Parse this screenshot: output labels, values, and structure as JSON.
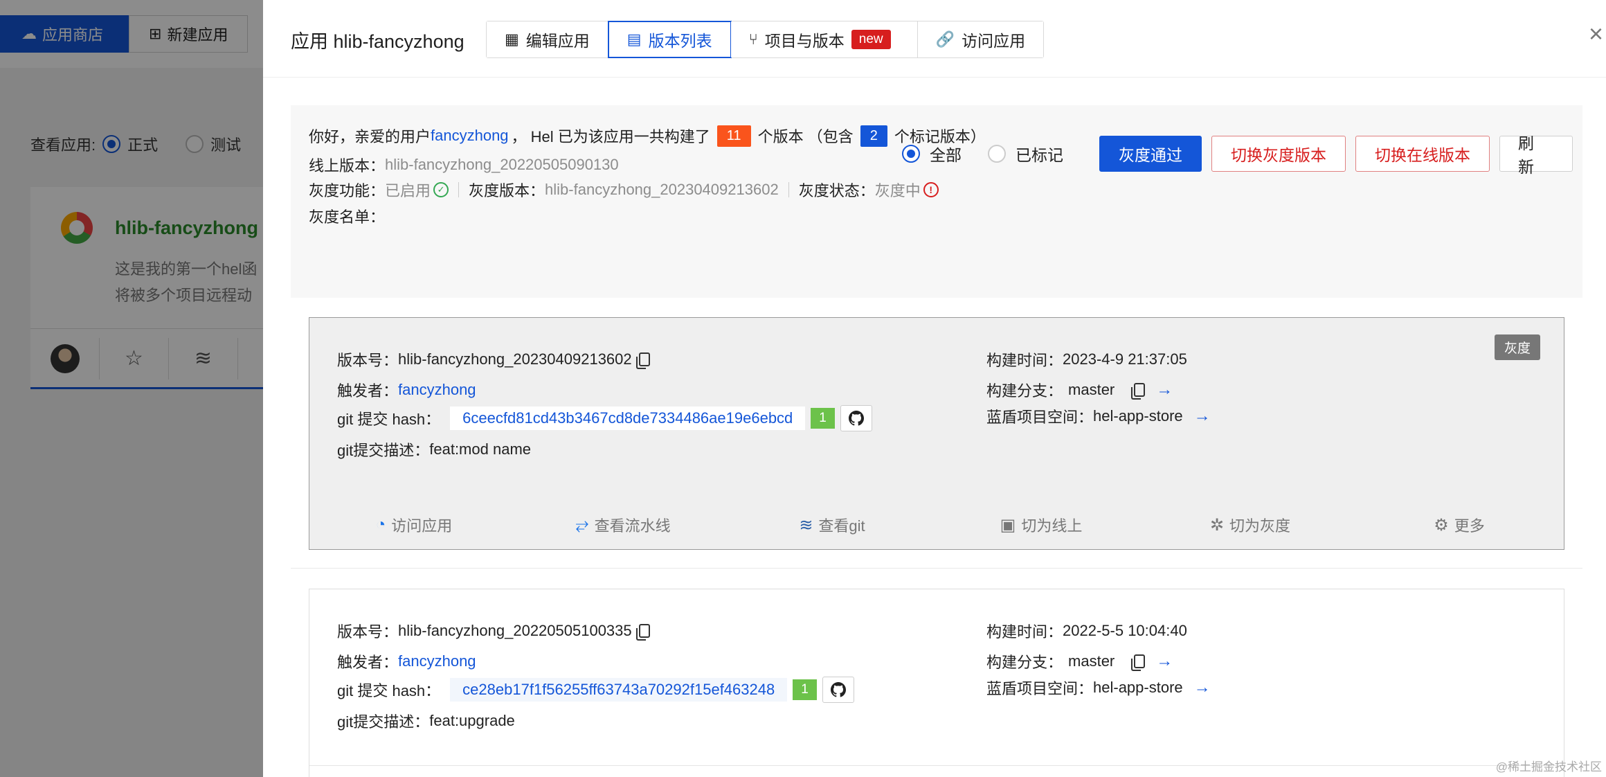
{
  "background": {
    "nav": [
      {
        "icon": "cloud-icon",
        "label": "应用商店"
      },
      {
        "icon": "plus-square-icon",
        "label": "新建应用"
      }
    ],
    "filter": {
      "label": "查看应用:",
      "options": [
        "正式",
        "测试"
      ]
    },
    "card": {
      "name": "hlib-fancyzhong",
      "desc_line1": "这是我的第一个hel函",
      "desc_line2": "将被多个项目远程动"
    }
  },
  "drawer": {
    "title": "应用 hlib-fancyzhong",
    "tabs": [
      {
        "label": "编辑应用",
        "icon": "grid-icon"
      },
      {
        "label": "版本列表",
        "icon": "list-icon"
      },
      {
        "label": "项目与版本",
        "icon": "branch-icon",
        "badge": "new"
      },
      {
        "label": "访问应用",
        "icon": "link-icon"
      }
    ],
    "close": "×"
  },
  "summary": {
    "greeting_prefix": "你好，亲爱的用户",
    "user": "fancyzhong",
    "greeting_mid": "，  Hel 已为该应用一共构建了",
    "total_versions": "11",
    "greeting_mid2": "个版本 （包含",
    "marked_versions": "2",
    "greeting_suffix": "个标记版本）",
    "online_label": "线上版本：",
    "online_value": "hlib-fancyzhong_20220505090130",
    "gray_feature_label": "灰度功能：",
    "gray_feature_value": "已启用",
    "gray_version_label": "灰度版本：",
    "gray_version_value": "hlib-fancyzhong_20230409213602",
    "gray_status_label": "灰度状态：",
    "gray_status_value": "灰度中",
    "gray_list_label": "灰度名单：",
    "colors": {
      "total_badge": "#fa541c",
      "marked_badge": "#1456d8"
    }
  },
  "controls": {
    "radio_all": "全部",
    "radio_marked": "已标记",
    "btn_pass": "灰度通过",
    "btn_switch_gray": "切换灰度版本",
    "btn_switch_online": "切换在线版本",
    "btn_refresh": "刷 新"
  },
  "versions": [
    {
      "tag": "灰度",
      "version_label": "版本号：",
      "version": "hlib-fancyzhong_20230409213602",
      "trigger_label": "触发者：",
      "trigger": "fancyzhong",
      "hash_label": "git 提交 hash：",
      "hash": "6ceecfd81cd43b3467cd8de7334486ae19e6ebcd",
      "hash_count": "1",
      "desc_label": "git提交描述：",
      "desc": "feat:mod name",
      "build_time_label": "构建时间：",
      "build_time": "2023-4-9 21:37:05",
      "branch_label": "构建分支：",
      "branch": "master",
      "space_label": "蓝盾项目空间：",
      "space": "hel-app-store",
      "actions": [
        {
          "icon": "visit-icon",
          "label": "访问应用"
        },
        {
          "icon": "pipeline-icon",
          "label": "查看流水线"
        },
        {
          "icon": "git-icon",
          "label": "查看git"
        },
        {
          "icon": "switch-online-icon",
          "label": "切为线上"
        },
        {
          "icon": "bug-icon",
          "label": "切为灰度"
        },
        {
          "icon": "gear-icon",
          "label": "更多"
        }
      ]
    },
    {
      "version_label": "版本号：",
      "version": "hlib-fancyzhong_20220505100335",
      "trigger_label": "触发者：",
      "trigger": "fancyzhong",
      "hash_label": "git 提交 hash：",
      "hash": "ce28eb17f1f56255ff63743a70292f15ef463248",
      "hash_count": "1",
      "desc_label": "git提交描述：",
      "desc": "feat:upgrade",
      "build_time_label": "构建时间：",
      "build_time": "2022-5-5 10:04:40",
      "branch_label": "构建分支：",
      "branch": "master",
      "space_label": "蓝盾项目空间：",
      "space": "hel-app-store"
    }
  ],
  "watermark": "@稀土掘金技术社区"
}
